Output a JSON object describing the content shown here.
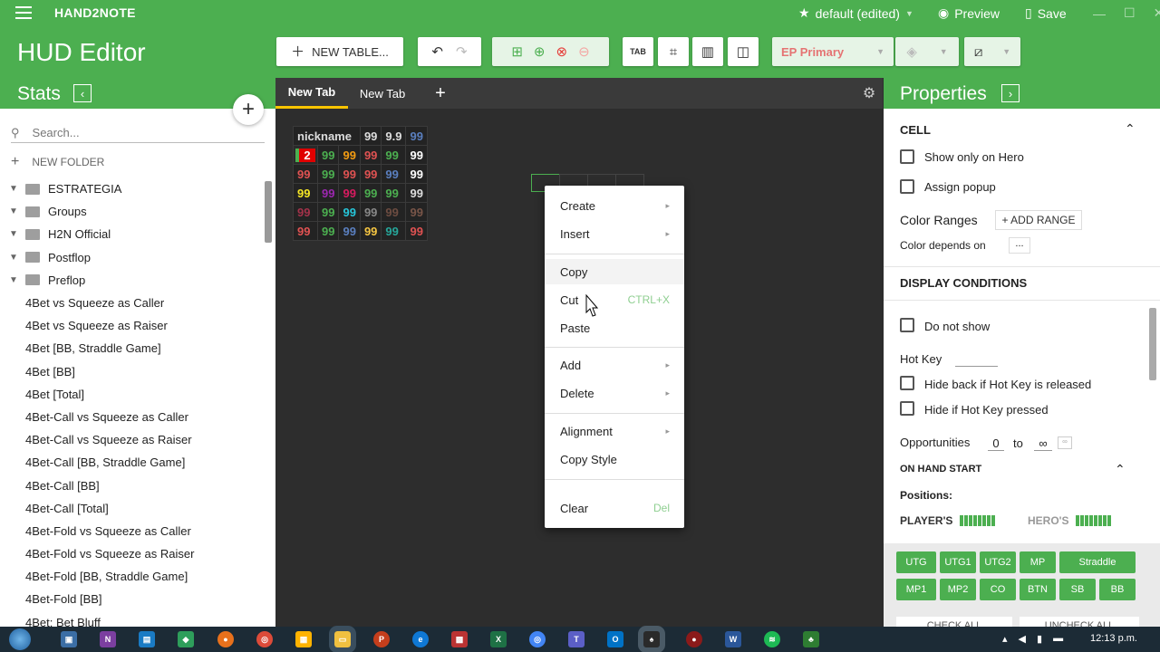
{
  "app": {
    "name": "HAND2NOTE",
    "layout": "default (edited)",
    "preview": "Preview",
    "save": "Save"
  },
  "header": {
    "title": "HUD Editor",
    "new_table": "NEW TABLE...",
    "tab_icon_label": "TAB",
    "ep_primary": "EP Primary"
  },
  "stats": {
    "title": "Stats",
    "search_placeholder": "Search...",
    "new_folder": "NEW FOLDER",
    "folders": [
      "ESTRATEGIA",
      "Groups",
      "H2N Official",
      "Postflop",
      "Preflop"
    ],
    "items": [
      "4Bet vs Squeeze as Caller",
      "4Bet vs Squeeze as Raiser",
      "4Bet [BB, Straddle Game]",
      "4Bet [BB]",
      "4Bet [Total]",
      "4Bet-Call vs Squeeze as Caller",
      "4Bet-Call vs Squeeze as Raiser",
      "4Bet-Call [BB, Straddle Game]",
      "4Bet-Call [BB]",
      "4Bet-Call [Total]",
      "4Bet-Fold vs Squeeze as Caller",
      "4Bet-Fold vs Squeeze as Raiser",
      "4Bet-Fold [BB, Straddle Game]",
      "4Bet-Fold [BB]",
      "4Bet: Bet Bluff"
    ]
  },
  "tabs": [
    {
      "label": "New Tab"
    },
    {
      "label": "New Tab"
    }
  ],
  "hud": {
    "header_row": [
      {
        "t": "nickname",
        "c": "#dddddd"
      },
      {
        "t": "99",
        "c": "#dddddd"
      },
      {
        "t": "9.9",
        "c": "#dddddd"
      },
      {
        "t": "99",
        "c": "#5a7fbf"
      }
    ],
    "badge": "2",
    "rows": [
      [
        {
          "t": "99",
          "c": "#4caf50"
        },
        {
          "t": "99",
          "c": "#f39c12"
        },
        {
          "t": "99",
          "c": "#e05252"
        },
        {
          "t": "99",
          "c": "#4caf50"
        },
        {
          "t": "99",
          "c": "#ffffff"
        }
      ],
      [
        {
          "t": "99",
          "c": "#e05252"
        },
        {
          "t": "99",
          "c": "#4caf50"
        },
        {
          "t": "99",
          "c": "#e05252"
        },
        {
          "t": "99",
          "c": "#e05252"
        },
        {
          "t": "99",
          "c": "#5a7fbf"
        },
        {
          "t": "99",
          "c": "#ffffff"
        }
      ],
      [
        {
          "t": "99",
          "c": "#f5e625"
        },
        {
          "t": "99",
          "c": "#9c27b0"
        },
        {
          "t": "99",
          "c": "#d81b60"
        },
        {
          "t": "99",
          "c": "#4caf50"
        },
        {
          "t": "99",
          "c": "#4caf50"
        },
        {
          "t": "99",
          "c": "#dddddd"
        }
      ],
      [
        {
          "t": "99",
          "c": "#a3324a"
        },
        {
          "t": "99",
          "c": "#4caf50"
        },
        {
          "t": "99",
          "c": "#26c6da"
        },
        {
          "t": "99",
          "c": "#888888"
        },
        {
          "t": "99",
          "c": "#6d4c41"
        },
        {
          "t": "99",
          "c": "#795548"
        }
      ],
      [
        {
          "t": "99",
          "c": "#e05252"
        },
        {
          "t": "99",
          "c": "#4caf50"
        },
        {
          "t": "99",
          "c": "#5a7fbf"
        },
        {
          "t": "99",
          "c": "#f5c542"
        },
        {
          "t": "99",
          "c": "#26a69a"
        },
        {
          "t": "99",
          "c": "#e05252"
        }
      ]
    ]
  },
  "context_menu": {
    "create": "Create",
    "insert": "Insert",
    "copy": "Copy",
    "cut": "Cut",
    "cut_shortcut": "CTRL+X",
    "paste": "Paste",
    "add": "Add",
    "delete": "Delete",
    "alignment": "Alignment",
    "copy_style": "Copy Style",
    "clear": "Clear",
    "clear_shortcut": "Del"
  },
  "properties": {
    "title": "Properties",
    "cell": "CELL",
    "show_only_hero": "Show only on Hero",
    "assign_popup": "Assign popup",
    "color_ranges": "Color Ranges",
    "add_range": "+ ADD RANGE",
    "color_depends": "Color depends on",
    "color_depends_value": "...",
    "display_conditions": "DISPLAY CONDITIONS",
    "do_not_show": "Do not show",
    "hot_key": "Hot Key",
    "hide_back": "Hide back if Hot Key is released",
    "hide_if": "Hide if Hot Key pressed",
    "opportunities": "Opportunities",
    "opp_from": "0",
    "opp_to_label": "to",
    "opp_to": "∞",
    "on_hand_start": "ON HAND START",
    "positions": "Positions:",
    "players": "PLAYER'S",
    "heros": "HERO'S",
    "position_buttons": [
      "UTG",
      "UTG1",
      "UTG2",
      "MP",
      "Straddle",
      "MP1",
      "MP2",
      "CO",
      "BTN",
      "SB",
      "BB"
    ],
    "check_all": "CHECK ALL",
    "uncheck_all": "UNCHECK ALL"
  },
  "taskbar": {
    "time": "12:13 p.m."
  }
}
